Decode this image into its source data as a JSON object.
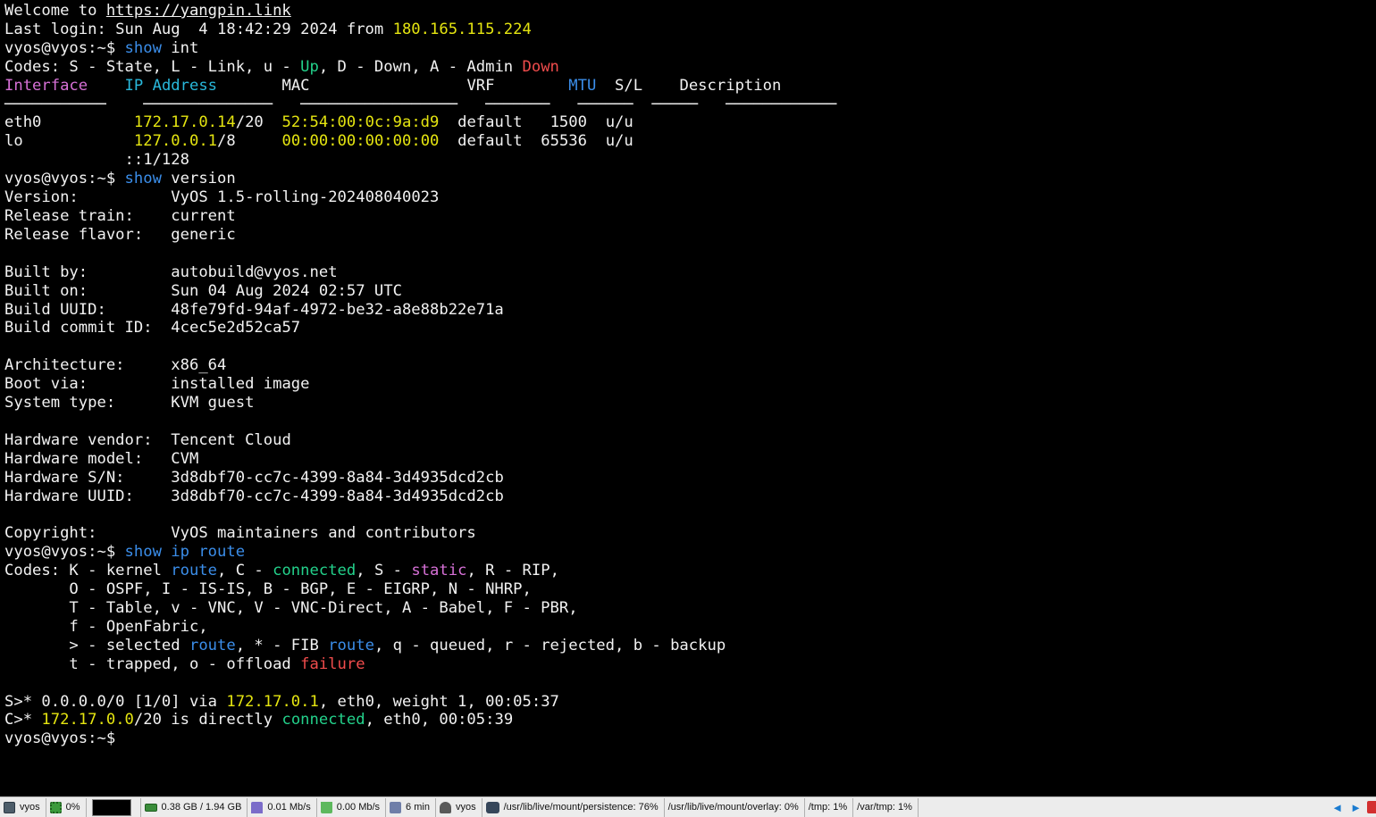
{
  "terminal": {
    "welcome_prefix": "Welcome to ",
    "welcome_link": "https://yangpin.link",
    "last_login_prefix": "Last login: Sun Aug  4 18:42:29 2024 from ",
    "last_login_ip": "180.165.115.224",
    "prompt": "vyos@vyos:~$ ",
    "cmd_show": "show",
    "cmd_int_arg": " int",
    "cmd_version_arg": " version",
    "cmd_iproute_arg": " ip route",
    "int_codes": {
      "prefix": "Codes: S - State, L - Link, u - ",
      "up": "Up",
      "mid": ", D - Down, A - Admin ",
      "down": "Down"
    },
    "int_table": {
      "h_interface": "Interface",
      "h_ip": "IP Address",
      "h_mac": "MAC",
      "h_vrf": "VRF",
      "h_mtu": "MTU",
      "h_sl": "S/L",
      "h_desc": "Description",
      "divider": "───────────    ──────────────   ─────────────────   ───────   ──────  ─────   ────────────",
      "rows": [
        {
          "iface": "eth0",
          "ip_a": "172.17.0.14",
          "ip_b": "/20",
          "mac": "52:54:00:0c:9a:d9",
          "vrf": "default",
          "mtu": "1500",
          "sl": "u/u"
        },
        {
          "iface": "lo",
          "ip_a": "127.0.0.1",
          "ip_b": "/8",
          "mac": "00:00:00:00:00:00",
          "vrf": "default",
          "mtu": "65536",
          "sl": "u/u"
        }
      ],
      "lo_ipv6": "::1/128"
    },
    "version": [
      {
        "k": "Version:",
        "v": "VyOS 1.5-rolling-202408040023"
      },
      {
        "k": "Release train:",
        "v": "current"
      },
      {
        "k": "Release flavor:",
        "v": "generic"
      },
      {
        "k": "Built by:",
        "v": "autobuild@vyos.net"
      },
      {
        "k": "Built on:",
        "v": "Sun 04 Aug 2024 02:57 UTC"
      },
      {
        "k": "Build UUID:",
        "v": "48fe79fd-94af-4972-be32-a8e88b22e71a"
      },
      {
        "k": "Build commit ID:",
        "v": "4cec5e2d52ca57"
      },
      {
        "k": "Architecture:",
        "v": "x86_64"
      },
      {
        "k": "Boot via:",
        "v": "installed image"
      },
      {
        "k": "System type:",
        "v": "KVM guest"
      },
      {
        "k": "Hardware vendor:",
        "v": "Tencent Cloud"
      },
      {
        "k": "Hardware model:",
        "v": "CVM"
      },
      {
        "k": "Hardware S/N:",
        "v": "3d8dbf70-cc7c-4399-8a84-3d4935dcd2cb"
      },
      {
        "k": "Hardware UUID:",
        "v": "3d8dbf70-cc7c-4399-8a84-3d4935dcd2cb"
      },
      {
        "k": "Copyright:",
        "v": "VyOS maintainers and contributors"
      }
    ],
    "route_codes": {
      "l1_a": "Codes: K - kernel ",
      "route": "route",
      "l1_b": ", C - ",
      "connected": "connected",
      "l1_c": ", S - ",
      "static": "static",
      "l1_d": ", R - RIP,",
      "l2": "       O - OSPF, I - IS-IS, B - BGP, E - EIGRP, N - NHRP,",
      "l3": "       T - Table, v - VNC, V - VNC-Direct, A - Babel, F - PBR,",
      "l4": "       f - OpenFabric,",
      "l5_a": "       > - selected ",
      "l5_b": ", * - FIB ",
      "l5_c": ", q - queued, r - rejected, b - backup",
      "l6_a": "       t - trapped, o - offload ",
      "failure": "failure"
    },
    "routes": {
      "r1_a": "S>* 0.0.0.0/0 [1/0] via ",
      "r1_ip": "172.17.0.1",
      "r1_b": ", eth0, weight 1, 00:05:37",
      "r2_a": "C>* ",
      "r2_ip": "172.17.0.0",
      "r2_b": "/20 is directly ",
      "r2_conn": "connected",
      "r2_c": ", eth0, 00:05:39"
    }
  },
  "taskbar": {
    "host": "vyos",
    "cpu": "0%",
    "ram": "0.38 GB / 1.94 GB",
    "net_up": "0.01 Mb/s",
    "net_down": "0.00 Mb/s",
    "uptime": "6 min",
    "user": "vyos",
    "disk_persistence": "/usr/lib/live/mount/persistence: 76%",
    "disk_overlay": "/usr/lib/live/mount/overlay: 0%",
    "disk_tmp": "/tmp: 1%",
    "disk_vartmp": "/var/tmp: 1%",
    "arrow_left": "◄",
    "arrow_right": "►"
  }
}
